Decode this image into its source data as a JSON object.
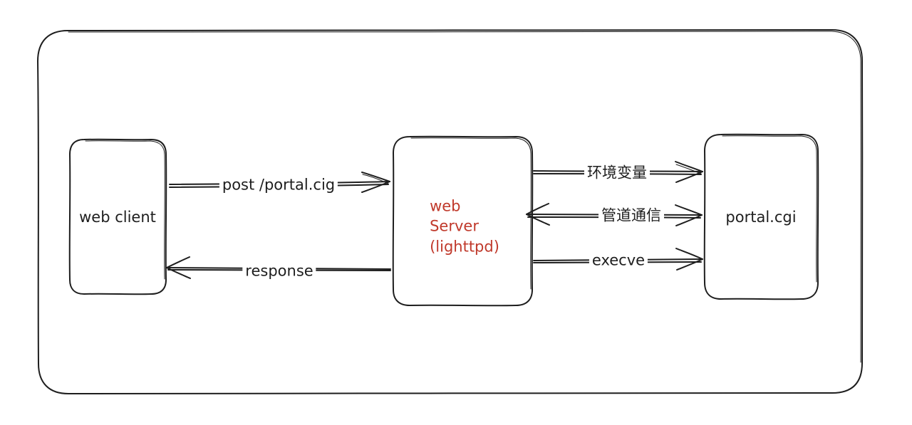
{
  "colors": {
    "stroke": "#1e1e1e",
    "accent": "#c0392b",
    "background": "#ffffff"
  },
  "nodes": {
    "client": {
      "label": "web client"
    },
    "server": {
      "line1": "web",
      "line2": "Server",
      "line3": "(lighttpd)"
    },
    "cgi": {
      "label": "portal.cgi"
    }
  },
  "edges": {
    "request": {
      "label": "post /portal.cig"
    },
    "response": {
      "label": "response"
    },
    "env": {
      "label": "环境变量"
    },
    "pipe": {
      "label": "管道通信"
    },
    "exec": {
      "label": "execve"
    }
  }
}
